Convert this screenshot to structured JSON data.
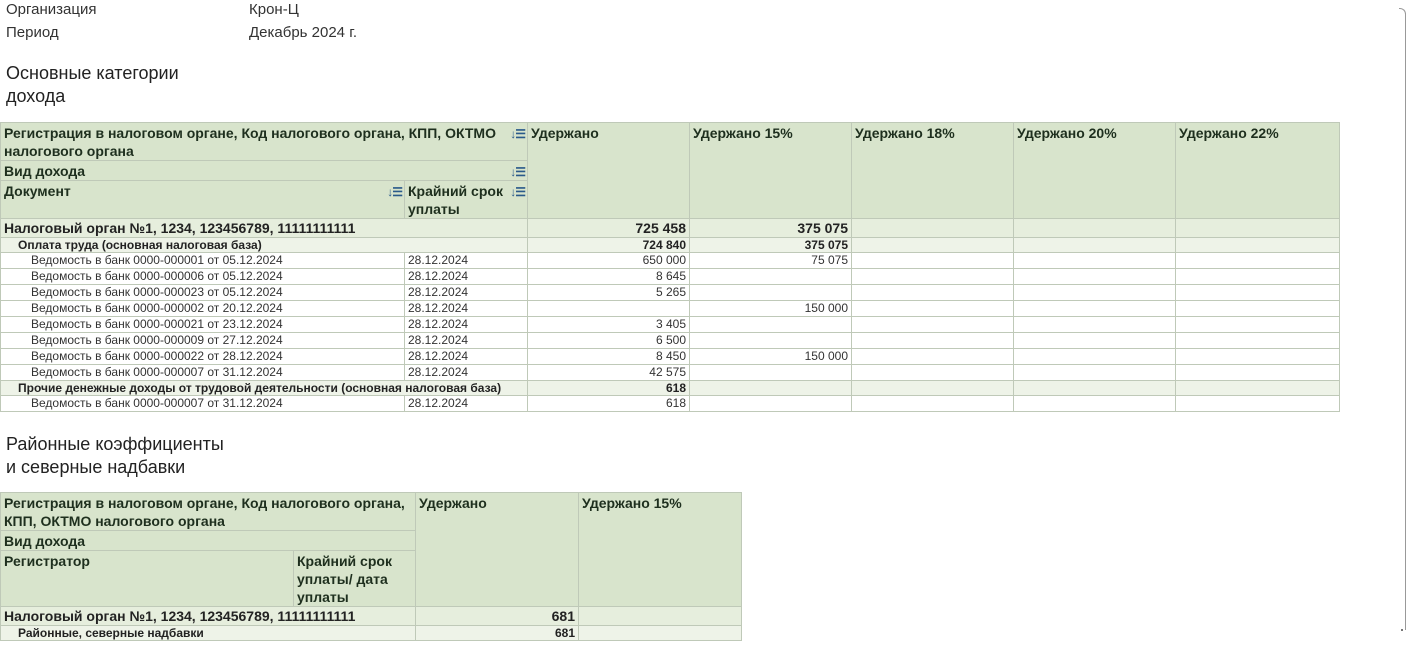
{
  "header": {
    "org_label": "Организация",
    "org_value": "Крон-Ц",
    "period_label": "Период",
    "period_value": "Декабрь 2024 г."
  },
  "section1": {
    "title_line1": "Основные категории",
    "title_line2": "дохода",
    "headers": {
      "registration": "Регистрация в налоговом органе, Код налогового органа, КПП, ОКТМО налогового органа",
      "income_type": "Вид дохода",
      "document": "Документ",
      "deadline": "Крайний срок уплаты",
      "withheld": "Удержано",
      "withheld15": "Удержано 15%",
      "withheld18": "Удержано 18%",
      "withheld20": "Удержано 20%",
      "withheld22": "Удержано 22%"
    },
    "group": {
      "name": "Налоговый орган №1, 1234, 123456789, 11111111111",
      "withheld": "725 458",
      "withheld15": "375 075"
    },
    "subgroups": [
      {
        "name": "Оплата труда (основная налоговая база)",
        "withheld": "724 840",
        "withheld15": "375 075",
        "rows": [
          {
            "doc": "Ведомость в банк 0000-000001 от 05.12.2024",
            "deadline": "28.12.2024",
            "withheld": "650 000",
            "withheld15": "75 075"
          },
          {
            "doc": "Ведомость в банк 0000-000006 от 05.12.2024",
            "deadline": "28.12.2024",
            "withheld": "8 645",
            "withheld15": ""
          },
          {
            "doc": "Ведомость в банк 0000-000023 от 05.12.2024",
            "deadline": "28.12.2024",
            "withheld": "5 265",
            "withheld15": ""
          },
          {
            "doc": "Ведомость в банк 0000-000002 от 20.12.2024",
            "deadline": "28.12.2024",
            "withheld": "",
            "withheld15": "150 000"
          },
          {
            "doc": "Ведомость в банк 0000-000021 от 23.12.2024",
            "deadline": "28.12.2024",
            "withheld": "3 405",
            "withheld15": ""
          },
          {
            "doc": "Ведомость в банк 0000-000009 от 27.12.2024",
            "deadline": "28.12.2024",
            "withheld": "6 500",
            "withheld15": ""
          },
          {
            "doc": "Ведомость в банк 0000-000022 от 28.12.2024",
            "deadline": "28.12.2024",
            "withheld": "8 450",
            "withheld15": "150 000"
          },
          {
            "doc": "Ведомость в банк 0000-000007 от 31.12.2024",
            "deadline": "28.12.2024",
            "withheld": "42 575",
            "withheld15": ""
          }
        ]
      },
      {
        "name": "Прочие денежные доходы от трудовой деятельности (основная налоговая база)",
        "withheld": "618",
        "withheld15": "",
        "rows": [
          {
            "doc": "Ведомость в банк 0000-000007 от 31.12.2024",
            "deadline": "28.12.2024",
            "withheld": "618",
            "withheld15": ""
          }
        ]
      }
    ]
  },
  "section2": {
    "title_line1": "Районные коэффициенты",
    "title_line2": "и северные надбавки",
    "headers": {
      "registration": "Регистрация в налоговом органе, Код налогового органа, КПП, ОКТМО налогового органа",
      "income_type": "Вид дохода",
      "registrar": "Регистратор",
      "deadline": "Крайний срок уплаты/ дата уплаты",
      "withheld": "Удержано",
      "withheld15": "Удержано 15%"
    },
    "group": {
      "name": "Налоговый орган №1, 1234, 123456789, 11111111111",
      "withheld": "681",
      "withheld15": ""
    },
    "subgroup": {
      "name": "Районные, северные надбавки",
      "withheld": "681",
      "withheld15": ""
    }
  }
}
